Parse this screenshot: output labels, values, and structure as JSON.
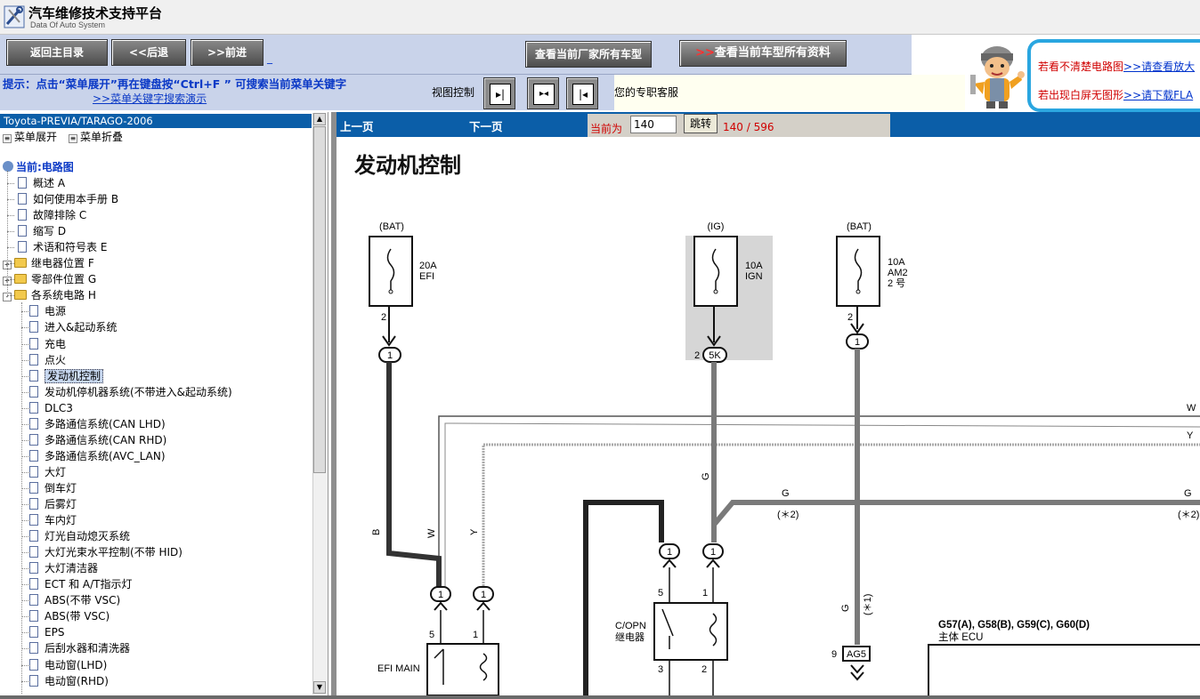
{
  "app": {
    "title": "汽车维修技术支持平台",
    "subtitle": "Data Of Auto System"
  },
  "nav": {
    "home": "返回主目录",
    "back": "<<后退",
    "forward": ">>前进",
    "underscore": "_",
    "all_models": "查看当前厂家所有车型",
    "all_docs": "查看当前车型所有资料",
    "all_docs_arrows": ">>"
  },
  "hint": {
    "text": "提示：点击“菜单展开”再在键盘按“Ctrl+F ” 可搜索当前菜单关键字",
    "link": ">>菜单关键字搜索演示",
    "view_control": "视图控制",
    "service": "您的专职客服"
  },
  "banner": {
    "line1_red": "若看不清楚电路图",
    "line1_link": ">>请查看放大",
    "line2_red": "若出现白屏无图形",
    "line2_link": ">>请下载FLA"
  },
  "tree": {
    "header": "Toyota-PREVIA/TARAGO-2006",
    "expand": "菜单展开",
    "collapse": "菜单折叠",
    "root": "当前:电路图",
    "items": [
      {
        "label": "概述  A",
        "type": "doc",
        "level": 1
      },
      {
        "label": "如何使用本手册  B",
        "type": "doc",
        "level": 1
      },
      {
        "label": "故障排除  C",
        "type": "doc",
        "level": 1
      },
      {
        "label": "缩写  D",
        "type": "doc",
        "level": 1
      },
      {
        "label": "术语和符号表  E",
        "type": "doc",
        "level": 1
      },
      {
        "label": "继电器位置  F",
        "type": "folder",
        "level": 1,
        "pm": "+"
      },
      {
        "label": "零部件位置  G",
        "type": "folder",
        "level": 1,
        "pm": "+"
      },
      {
        "label": "各系统电路  H",
        "type": "folder",
        "level": 1,
        "pm": "-"
      },
      {
        "label": "电源",
        "type": "doc",
        "level": 2
      },
      {
        "label": "进入&起动系统",
        "type": "doc",
        "level": 2
      },
      {
        "label": "充电",
        "type": "doc",
        "level": 2
      },
      {
        "label": "点火",
        "type": "doc",
        "level": 2
      },
      {
        "label": "发动机控制",
        "type": "doc",
        "level": 2,
        "selected": true
      },
      {
        "label": "发动机停机器系统(不带进入&起动系统)",
        "type": "doc",
        "level": 2
      },
      {
        "label": "DLC3",
        "type": "doc",
        "level": 2
      },
      {
        "label": "多路通信系统(CAN LHD)",
        "type": "doc",
        "level": 2
      },
      {
        "label": "多路通信系统(CAN RHD)",
        "type": "doc",
        "level": 2
      },
      {
        "label": "多路通信系统(AVC_LAN)",
        "type": "doc",
        "level": 2
      },
      {
        "label": "大灯",
        "type": "doc",
        "level": 2
      },
      {
        "label": "倒车灯",
        "type": "doc",
        "level": 2
      },
      {
        "label": "后雾灯",
        "type": "doc",
        "level": 2
      },
      {
        "label": "车内灯",
        "type": "doc",
        "level": 2
      },
      {
        "label": "灯光自动熄灭系统",
        "type": "doc",
        "level": 2
      },
      {
        "label": "大灯光束水平控制(不带  HID)",
        "type": "doc",
        "level": 2
      },
      {
        "label": "大灯清洁器",
        "type": "doc",
        "level": 2
      },
      {
        "label": "ECT 和  A/T指示灯",
        "type": "doc",
        "level": 2
      },
      {
        "label": "ABS(不带  VSC)",
        "type": "doc",
        "level": 2
      },
      {
        "label": "ABS(带  VSC)",
        "type": "doc",
        "level": 2
      },
      {
        "label": "EPS",
        "type": "doc",
        "level": 2
      },
      {
        "label": "后刮水器和清洗器",
        "type": "doc",
        "level": 2
      },
      {
        "label": "电动窗(LHD)",
        "type": "doc",
        "level": 2
      },
      {
        "label": "电动窗(RHD)",
        "type": "doc",
        "level": 2
      }
    ]
  },
  "pager": {
    "prev": "上一页",
    "next": "下一页",
    "current_label": "当前为",
    "current_value": "140",
    "jump": "跳转",
    "count": "140 / 596"
  },
  "diagram": {
    "title": "发动机控制",
    "fuse1": {
      "source": "(BAT)",
      "rating": "20A",
      "name": "EFI",
      "pin": "2",
      "conn": "1"
    },
    "fuse2": {
      "source": "(IG)",
      "rating": "10A",
      "name": "IGN",
      "pin": "2",
      "conn": "5K"
    },
    "fuse3": {
      "source": "(BAT)",
      "rating": "10A",
      "name": "AM2",
      "extra": "2 号",
      "pin": "2",
      "conn": "1"
    },
    "wire_w": "W",
    "wire_y": "Y",
    "wire_b": "B",
    "wire_g": "G",
    "star2": "(＊2)",
    "star1": "(＊1)",
    "conn1": "1",
    "pin5": "5",
    "pin1": "1",
    "pin3": "3",
    "pin9": "9",
    "relay1": "EFI MAIN",
    "relay2_line1": "C/OPN",
    "relay2_line2": "继电器",
    "ag5": "AG5",
    "ecu_line1": "G57(A), G58(B), G59(C), G60(D)",
    "ecu_line2": "主体 ECU"
  }
}
